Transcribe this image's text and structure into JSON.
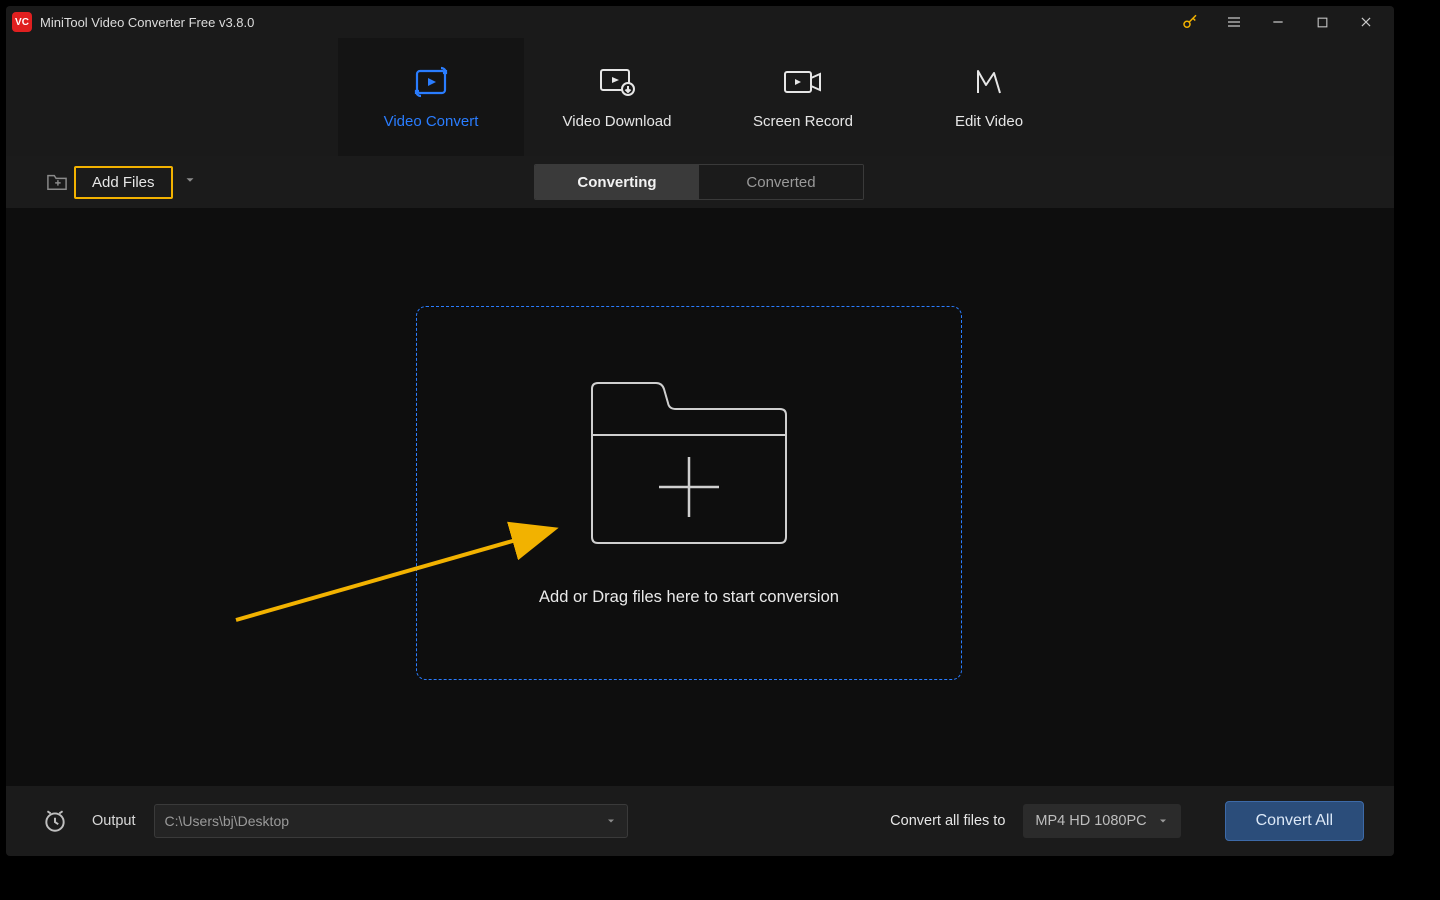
{
  "app_title": "MiniTool Video Converter Free v3.8.0",
  "logo_text": "VC",
  "topnav": {
    "tabs": [
      {
        "label": "Video Convert"
      },
      {
        "label": "Video Download"
      },
      {
        "label": "Screen Record"
      },
      {
        "label": "Edit Video"
      }
    ]
  },
  "toolbar": {
    "add_files_label": "Add Files",
    "segments": {
      "converting": "Converting",
      "converted": "Converted"
    }
  },
  "dropzone": {
    "text": "Add or Drag files here to start conversion"
  },
  "bottombar": {
    "output_label": "Output",
    "output_path": "C:\\Users\\bj\\Desktop",
    "convert_all_label": "Convert all files to",
    "format": "MP4 HD 1080PC",
    "convert_button": "Convert All"
  },
  "colors": {
    "accent": "#2a7dff",
    "highlight": "#f2b200"
  }
}
